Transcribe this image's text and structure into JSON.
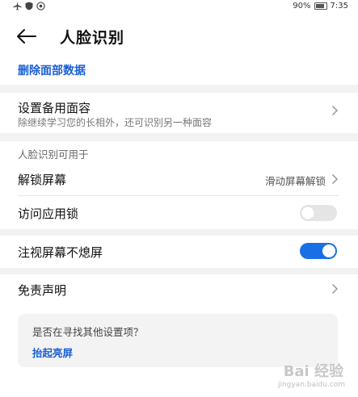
{
  "status_bar": {
    "left_icons": [
      "airplane-icon",
      "shield-icon",
      "location-icon"
    ],
    "battery_percent": "90%",
    "time": "7:35"
  },
  "header": {
    "title": "人脸识别"
  },
  "delete_link": "删除面部数据",
  "backup_face": {
    "title": "设置备用面容",
    "subtitle": "除继续学习您的长相外，还可识别另一种面容"
  },
  "usage_section_label": "人脸识别可用于",
  "unlock_screen": {
    "title": "解锁屏幕",
    "value": "滑动屏幕解锁"
  },
  "app_lock": {
    "title": "访问应用锁",
    "enabled": false
  },
  "gaze_screen_on": {
    "title": "注视屏幕不熄屏",
    "enabled": true
  },
  "disclaimer": {
    "title": "免责声明"
  },
  "suggestion_card": {
    "question": "是否在寻找其他设置项？",
    "link": "抬起亮屏"
  },
  "watermark": {
    "text": "Bai 经验",
    "sub": "jingyan.baidu.com"
  },
  "colors": {
    "accent": "#1a6fe6",
    "link": "#1a5fd6",
    "separator": "#f2f2f2"
  }
}
